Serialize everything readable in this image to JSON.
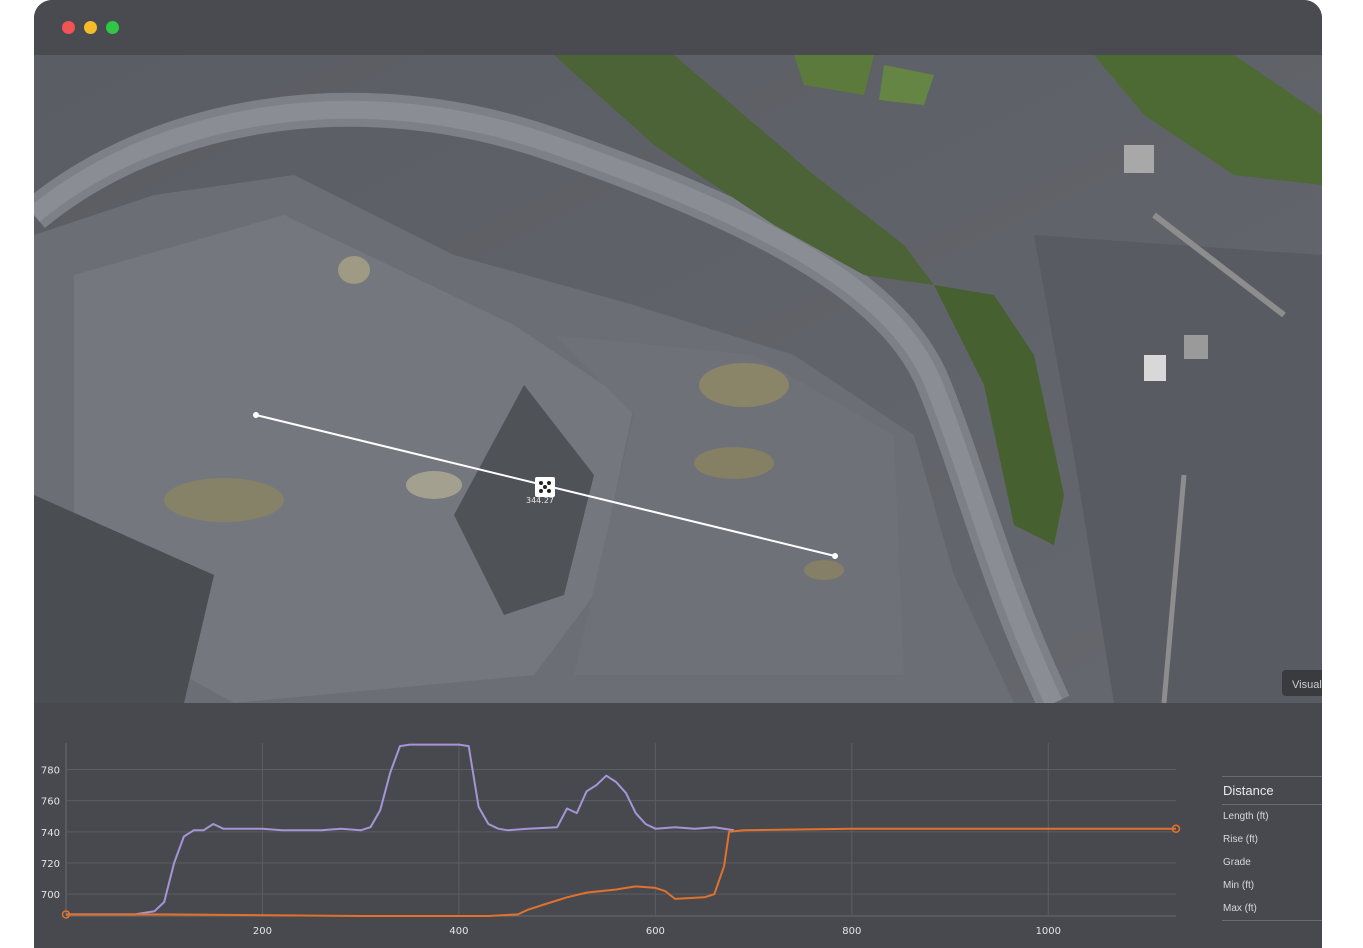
{
  "window": {
    "controls": [
      "close",
      "minimize",
      "maximize"
    ]
  },
  "map": {
    "measurement_label": "344.27",
    "visual_tab_label": "Visual"
  },
  "profile_panel": {
    "stats": {
      "title": "Distance",
      "rows": [
        "Length (ft)",
        "Rise (ft)",
        "Grade",
        "Min (ft)",
        "Max (ft)"
      ]
    }
  },
  "colors": {
    "surface_line": "#a594d6",
    "design_line": "#e0722e",
    "panel_bg": "#48494e",
    "grid": "#5c5d62"
  },
  "chart_data": {
    "type": "line",
    "xlabel": "",
    "ylabel": "",
    "xlim": [
      0,
      1130
    ],
    "ylim": [
      686,
      797
    ],
    "x_ticks": [
      200,
      400,
      600,
      800,
      1000
    ],
    "y_ticks": [
      700,
      720,
      740,
      760,
      780
    ],
    "grid": true,
    "series": [
      {
        "color": "#a594d6",
        "points": [
          [
            0,
            687
          ],
          [
            70,
            687
          ],
          [
            90,
            689
          ],
          [
            100,
            695
          ],
          [
            110,
            720
          ],
          [
            120,
            737
          ],
          [
            130,
            741
          ],
          [
            140,
            741
          ],
          [
            150,
            745
          ],
          [
            160,
            742
          ],
          [
            180,
            742
          ],
          [
            200,
            742
          ],
          [
            220,
            741
          ],
          [
            260,
            741
          ],
          [
            280,
            742
          ],
          [
            300,
            741
          ],
          [
            310,
            743
          ],
          [
            320,
            754
          ],
          [
            330,
            778
          ],
          [
            340,
            795
          ],
          [
            350,
            796
          ],
          [
            400,
            796
          ],
          [
            410,
            795
          ],
          [
            420,
            756
          ],
          [
            430,
            745
          ],
          [
            440,
            742
          ],
          [
            450,
            741
          ],
          [
            470,
            742
          ],
          [
            500,
            743
          ],
          [
            510,
            755
          ],
          [
            520,
            752
          ],
          [
            530,
            766
          ],
          [
            540,
            770
          ],
          [
            550,
            776
          ],
          [
            560,
            772
          ],
          [
            570,
            765
          ],
          [
            580,
            752
          ],
          [
            590,
            745
          ],
          [
            600,
            742
          ],
          [
            620,
            743
          ],
          [
            640,
            742
          ],
          [
            660,
            743
          ],
          [
            680,
            741
          ]
        ]
      },
      {
        "color": "#e0722e",
        "points": [
          [
            0,
            687
          ],
          [
            100,
            687
          ],
          [
            300,
            686
          ],
          [
            430,
            686
          ],
          [
            460,
            687
          ],
          [
            470,
            690
          ],
          [
            490,
            694
          ],
          [
            510,
            698
          ],
          [
            530,
            701
          ],
          [
            560,
            703
          ],
          [
            580,
            705
          ],
          [
            600,
            704
          ],
          [
            610,
            702
          ],
          [
            620,
            697
          ],
          [
            650,
            698
          ],
          [
            660,
            700
          ],
          [
            670,
            718
          ],
          [
            675,
            740
          ],
          [
            690,
            741
          ],
          [
            800,
            742
          ],
          [
            900,
            742
          ],
          [
            1000,
            742
          ],
          [
            1130,
            742
          ]
        ]
      }
    ]
  }
}
